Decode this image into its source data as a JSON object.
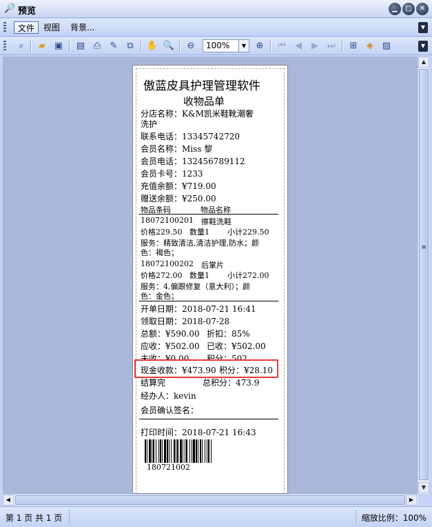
{
  "window": {
    "title": "预览"
  },
  "menu": {
    "items": [
      "文件",
      "视图",
      "背景..."
    ]
  },
  "toolbar": {
    "zoom": "100%"
  },
  "receipt": {
    "company": "傲蓝皮具护理管理软件",
    "doc_title": "收物品单",
    "store_line1": "分店名称：K&M凯米鞋靴潮奢",
    "store_line2": "洗护",
    "phone": "联系电话：13345742720",
    "member_name": "会员名称：Miss 黎",
    "member_phone": "会员电话：132456789112",
    "card_no": "会员卡号：1233",
    "recharge_balance": "充值余额：¥719.00",
    "gift_balance": "赠送余额：¥250.00",
    "col_code": "物品条码",
    "col_name": "物品名称",
    "items": [
      {
        "code": "18072100201",
        "name": "擦鞋洗鞋",
        "price": "价格229.50",
        "qty": "数量1",
        "subtotal": "小计229.50",
        "service1": "服务：精致清洁,清洁护理,防水；颜",
        "service2": "色：褐色；"
      },
      {
        "code": "18072100202",
        "name": "后掌片",
        "price": "价格272.00",
        "qty": "数量1",
        "subtotal": "小计272.00",
        "service1": "服务：4,偏跟修复（意大利）；颜",
        "service2": "色：金色；"
      }
    ],
    "open_date": "开单日期：2018-07-21 16:41",
    "pickup_date": "领取日期：2018-07-28",
    "total": "总额：¥590.00",
    "discount": "折扣：85%",
    "receivable": "应收：¥502.00",
    "received": "已收：¥502.00",
    "unpaid": "未收：¥0.00",
    "points": "积分：502",
    "cash": "现金收款：¥473.90",
    "points_pay": "积分：¥28.10",
    "settled": "结算完",
    "total_points": "总积分：473.9",
    "operator": "经办人：kevin",
    "signature": "会员确认签名：",
    "print_time": "打印时间：2018-07-21 16:43",
    "barcode_text": "180721002"
  },
  "status": {
    "pages": "第 1 页 共 1 页",
    "zoom": "缩放比例：100%"
  }
}
